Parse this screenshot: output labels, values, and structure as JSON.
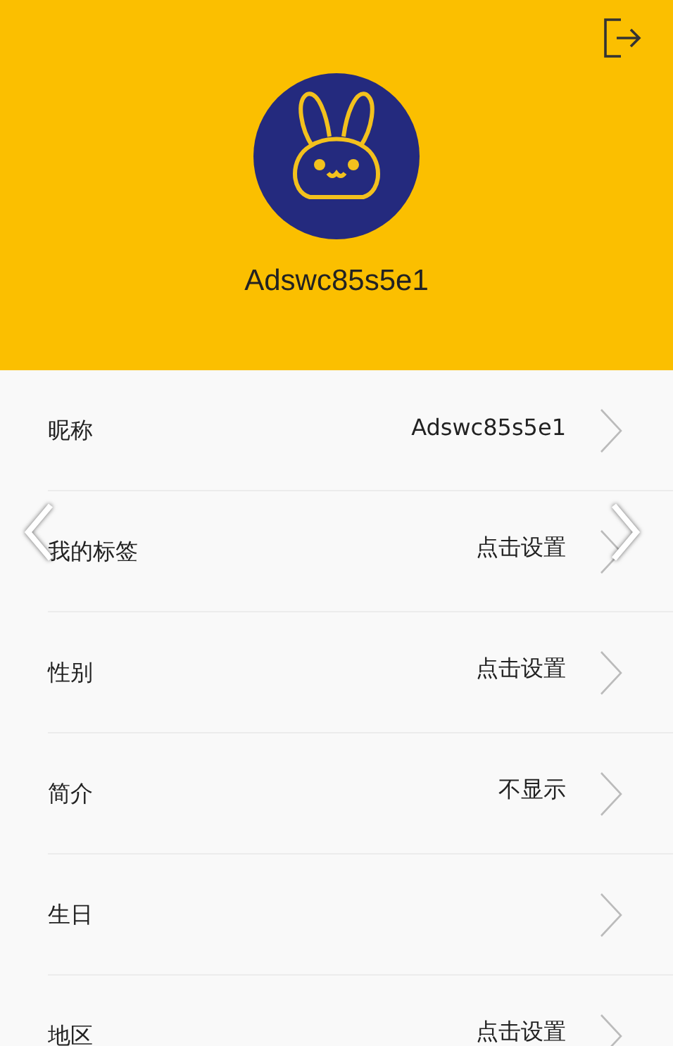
{
  "header": {
    "username": "Adswc85s5e1"
  },
  "rows": [
    {
      "label": "昵称",
      "value": "Adswc85s5e1"
    },
    {
      "label": "我的标签",
      "value": "点击设置"
    },
    {
      "label": "性别",
      "value": "点击设置"
    },
    {
      "label": "简介",
      "value": "不显示"
    },
    {
      "label": "生日"
    },
    {
      "label": "地区",
      "value": "点击设置"
    }
  ]
}
